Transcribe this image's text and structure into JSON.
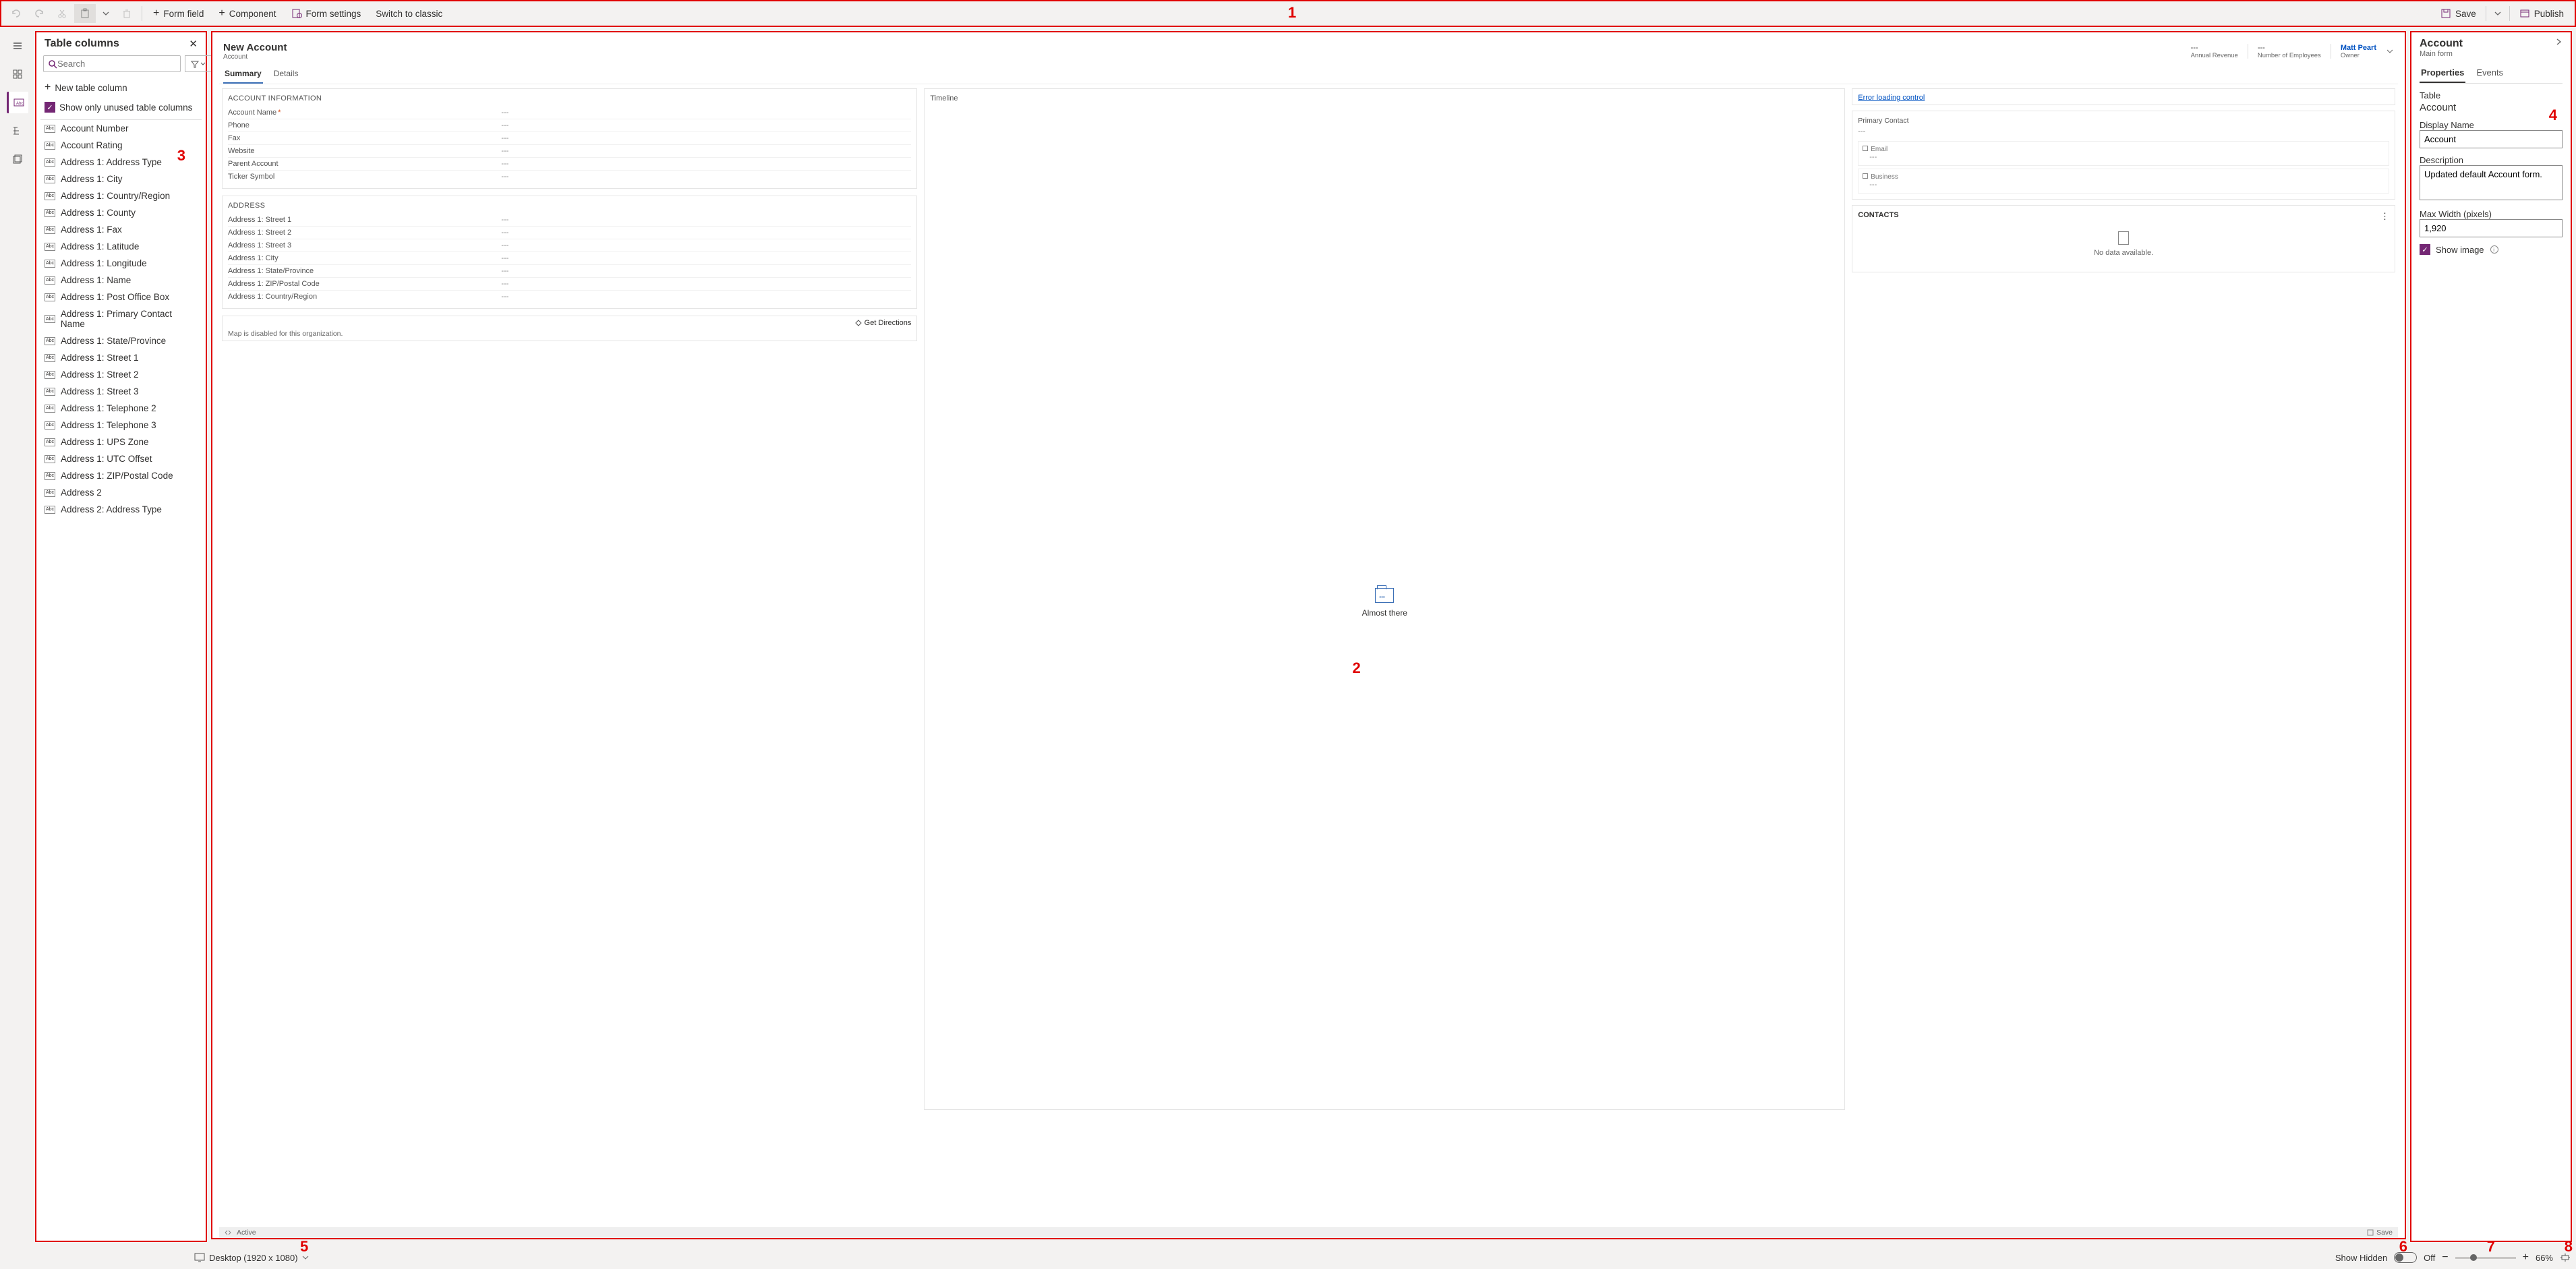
{
  "toolbar": {
    "formFieldLabel": "Form field",
    "componentLabel": "Component",
    "formSettingsLabel": "Form settings",
    "switchLabel": "Switch to classic",
    "saveLabel": "Save",
    "publishLabel": "Publish"
  },
  "tablePanel": {
    "title": "Table columns",
    "searchPlaceholder": "Search",
    "newColLabel": "New table column",
    "showUnusedLabel": "Show only unused table columns",
    "columns": [
      "Account Number",
      "Account Rating",
      "Address 1: Address Type",
      "Address 1: City",
      "Address 1: Country/Region",
      "Address 1: County",
      "Address 1: Fax",
      "Address 1: Latitude",
      "Address 1: Longitude",
      "Address 1: Name",
      "Address 1: Post Office Box",
      "Address 1: Primary Contact Name",
      "Address 1: State/Province",
      "Address 1: Street 1",
      "Address 1: Street 2",
      "Address 1: Street 3",
      "Address 1: Telephone 2",
      "Address 1: Telephone 3",
      "Address 1: UPS Zone",
      "Address 1: UTC Offset",
      "Address 1: ZIP/Postal Code",
      "Address 2",
      "Address 2: Address Type"
    ]
  },
  "form": {
    "title": "New Account",
    "entity": "Account",
    "headerFields": [
      {
        "value": "---",
        "label": "Annual Revenue"
      },
      {
        "value": "---",
        "label": "Number of Employees"
      }
    ],
    "owner": {
      "value": "Matt Peart",
      "label": "Owner"
    },
    "tabs": [
      "Summary",
      "Details"
    ],
    "accountInfoTitle": "ACCOUNT INFORMATION",
    "accountFields": [
      {
        "label": "Account Name",
        "value": "---",
        "required": true
      },
      {
        "label": "Phone",
        "value": "---"
      },
      {
        "label": "Fax",
        "value": "---"
      },
      {
        "label": "Website",
        "value": "---"
      },
      {
        "label": "Parent Account",
        "value": "---"
      },
      {
        "label": "Ticker Symbol",
        "value": "---"
      }
    ],
    "addressTitle": "ADDRESS",
    "addressFields": [
      {
        "label": "Address 1: Street 1",
        "value": "---"
      },
      {
        "label": "Address 1: Street 2",
        "value": "---"
      },
      {
        "label": "Address 1: Street 3",
        "value": "---"
      },
      {
        "label": "Address 1: City",
        "value": "---"
      },
      {
        "label": "Address 1: State/Province",
        "value": "---"
      },
      {
        "label": "Address 1: ZIP/Postal Code",
        "value": "---"
      },
      {
        "label": "Address 1: Country/Region",
        "value": "---"
      }
    ],
    "getDirections": "Get Directions",
    "mapDisabled": "Map is disabled for this organization.",
    "timelineTitle": "Timeline",
    "almostThere": "Almost there",
    "errorLink": "Error loading control",
    "primaryContact": "Primary Contact",
    "primaryContactValue": "---",
    "emailLabel": "Email",
    "emailValue": "---",
    "businessLabel": "Business",
    "businessValue": "---",
    "contactsTitle": "CONTACTS",
    "noData": "No data available.",
    "footerStatus": "Active",
    "footerSave": "Save"
  },
  "propPanel": {
    "title": "Account",
    "subtitle": "Main form",
    "tabs": [
      "Properties",
      "Events"
    ],
    "tableLabel": "Table",
    "tableValue": "Account",
    "dispLabel": "Display Name",
    "dispValue": "Account",
    "descLabel": "Description",
    "descValue": "Updated default Account form.",
    "maxWidthLabel": "Max Width (pixels)",
    "maxWidthValue": "1,920",
    "showImageLabel": "Show image"
  },
  "statusbar": {
    "viewport": "Desktop (1920 x 1080)",
    "showHidden": "Show Hidden",
    "toggleState": "Off",
    "zoomPct": "66%"
  },
  "annotations": {
    "a1": "1",
    "a2": "2",
    "a3": "3",
    "a4": "4",
    "a5": "5",
    "a6": "6",
    "a7": "7",
    "a8": "8"
  }
}
